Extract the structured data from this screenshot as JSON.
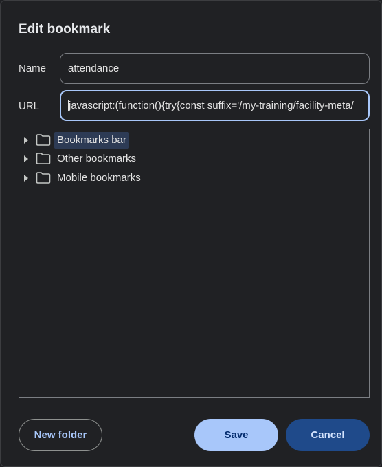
{
  "dialog": {
    "title": "Edit bookmark"
  },
  "name_field": {
    "label": "Name",
    "value": "attendance"
  },
  "url_field": {
    "label": "URL",
    "value": "javascript:(function(){try{const suffix='/my-training/facility-meta/"
  },
  "tree": {
    "items": [
      {
        "label": "Bookmarks bar",
        "icon": "folder-icon",
        "selected": true
      },
      {
        "label": "Other bookmarks",
        "icon": "folder-icon",
        "selected": false
      },
      {
        "label": "Mobile bookmarks",
        "icon": "folder-icon",
        "selected": false
      }
    ]
  },
  "buttons": {
    "new_folder": "New folder",
    "save": "Save",
    "cancel": "Cancel"
  },
  "colors": {
    "background": "#202124",
    "accent": "#a8c7fa",
    "selection": "#2d3b55",
    "cancel_bg": "#1f4a8a"
  }
}
